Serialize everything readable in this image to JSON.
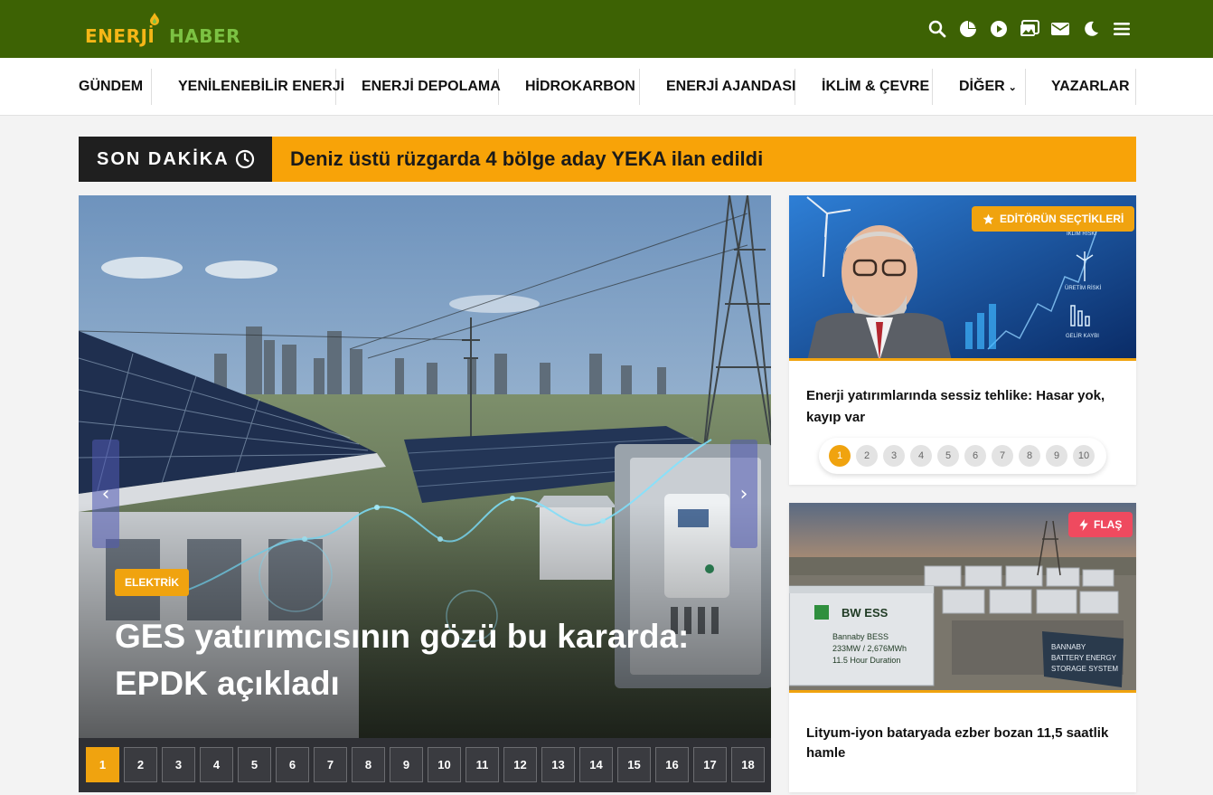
{
  "header": {
    "logo_part1": "ENERJİ",
    "logo_part2": "HABER",
    "bg_color": "#3d6204",
    "icons": [
      "search-icon",
      "pie-chart-icon",
      "play-icon",
      "gallery-icon",
      "mail-icon",
      "moon-icon",
      "menu-icon"
    ]
  },
  "nav": {
    "items": [
      {
        "label": "GÜNDEM"
      },
      {
        "label": "YENİLENEBİLİR ENERJİ"
      },
      {
        "label": "ENERJİ DEPOLAMA"
      },
      {
        "label": "HİDROKARBON"
      },
      {
        "label": "ENERJİ AJANDASI"
      },
      {
        "label": "İKLİM & ÇEVRE"
      },
      {
        "label": "DİĞER"
      },
      {
        "label": "YAZARLAR"
      }
    ]
  },
  "breaking": {
    "label": "SON DAKİKA",
    "headline": "Deniz üstü rüzgarda 4 bölge aday YEKA ilan edildi",
    "accent": "#f8a308"
  },
  "hero": {
    "category": "ELEKTRİK",
    "title": "GES yatırımcısının gözü bu kararda: EPDK açıkladı",
    "pages": [
      "1",
      "2",
      "3",
      "4",
      "5",
      "6",
      "7",
      "8",
      "9",
      "10",
      "11",
      "12",
      "13",
      "14",
      "15",
      "16",
      "17",
      "18"
    ],
    "active_page": "1"
  },
  "editor_card": {
    "badge": "EDİTÖRÜN SEÇTİKLERİ",
    "title": "Enerji yatırımlarında sessiz tehlike: Hasar yok, kayıp var",
    "image_labels": [
      "İKLİM RİSKİ",
      "ÜRETİM RİSKİ",
      "GELİR KAYBI"
    ],
    "pages": [
      "1",
      "2",
      "3",
      "4",
      "5",
      "6",
      "7",
      "8",
      "9",
      "10"
    ],
    "active_page": "1"
  },
  "flash_card": {
    "badge": "FLAŞ",
    "title": "Lityum-iyon bataryada ezber bozan 11,5 saatlik hamle",
    "image_texts": [
      "BW ESS",
      "Bannaby BESS",
      "233MW / 2,676MWh",
      "11.5 Hour Duration",
      "BANNABY",
      "BATTERY ENERGY",
      "STORAGE SYSTEM"
    ]
  }
}
